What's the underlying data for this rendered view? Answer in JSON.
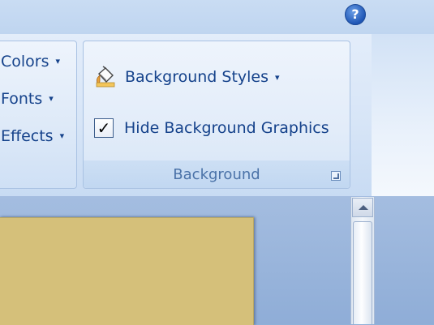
{
  "help": {
    "glyph": "?",
    "icon": "help-icon"
  },
  "themes_group": {
    "items": [
      {
        "label": "Colors"
      },
      {
        "label": "Fonts"
      },
      {
        "label": "Effects"
      }
    ],
    "caret": "▾"
  },
  "background_group": {
    "label": "Background",
    "styles_button": {
      "label": "Background Styles",
      "icon": "paint-bucket-icon",
      "caret": "▾"
    },
    "hide_graphics": {
      "label": "Hide Background Graphics",
      "checked": true,
      "check_glyph": "✓"
    },
    "launcher_icon": "dialog-launcher-icon"
  },
  "slide": {
    "color": "#d5c07a"
  },
  "colors": {
    "ribbon_text": "#15428b",
    "group_label": "#4a72a8",
    "accent_help": "#1f56b5"
  }
}
